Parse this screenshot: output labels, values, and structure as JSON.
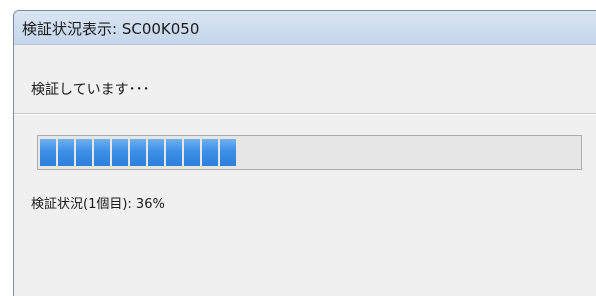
{
  "window": {
    "title": "検証状況表示: SC00K050"
  },
  "dialog": {
    "message": "検証しています･･･",
    "progress": {
      "percent": 36,
      "segments_filled": 11
    },
    "detail": "検証状況(1個目): 36%"
  },
  "colors": {
    "progress_fill": "#3c8fe6",
    "titlebar": "#cddcee",
    "background": "#f0f0f0"
  }
}
